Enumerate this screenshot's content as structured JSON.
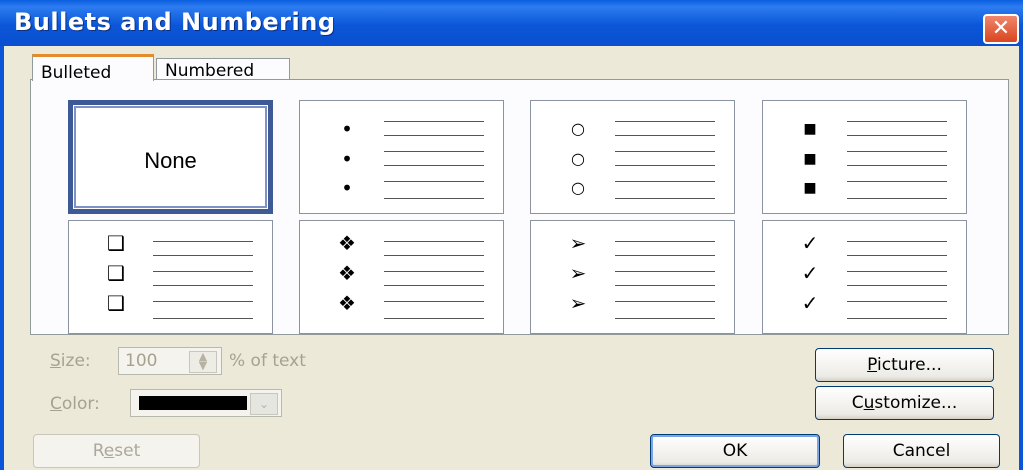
{
  "window": {
    "title": "Bullets and Numbering",
    "close_glyph": "✕"
  },
  "tabs": [
    {
      "label": "Bulleted",
      "active": true
    },
    {
      "label": "Numbered",
      "active": false
    }
  ],
  "gallery": {
    "none_label": "None",
    "cells": [
      {
        "name": "none"
      },
      {
        "name": "filled-dot",
        "glyph": "•"
      },
      {
        "name": "hollow-circle",
        "glyph": "○"
      },
      {
        "name": "filled-square",
        "glyph": "■"
      },
      {
        "name": "hollow-square",
        "glyph": "❑"
      },
      {
        "name": "four-diamond",
        "glyph": "❖"
      },
      {
        "name": "arrowhead",
        "glyph": "➢"
      },
      {
        "name": "checkmark",
        "glyph": "✓"
      }
    ]
  },
  "size": {
    "label_pre": "S",
    "label_post": "ize:",
    "value": "100",
    "suffix": "% of text",
    "spin_up": "▲",
    "spin_down": "▼"
  },
  "color": {
    "label_pre": "C",
    "label_post": "olor:",
    "value": "#000000",
    "dropdown_glyph": "⌄"
  },
  "buttons": {
    "picture": {
      "pre": "P",
      "post": "icture..."
    },
    "customize": {
      "pre": "C",
      "mid": "u",
      "post": "stomize..."
    },
    "reset": {
      "pre": "R",
      "mid": "e",
      "post": "set"
    },
    "ok": "OK",
    "cancel": "Cancel"
  },
  "colors": {
    "titlebar": "#0b56d8",
    "dialog_bg": "#ece9d8",
    "selected_border": "#3d5a96",
    "active_tab_accent": "#e68b2c"
  }
}
